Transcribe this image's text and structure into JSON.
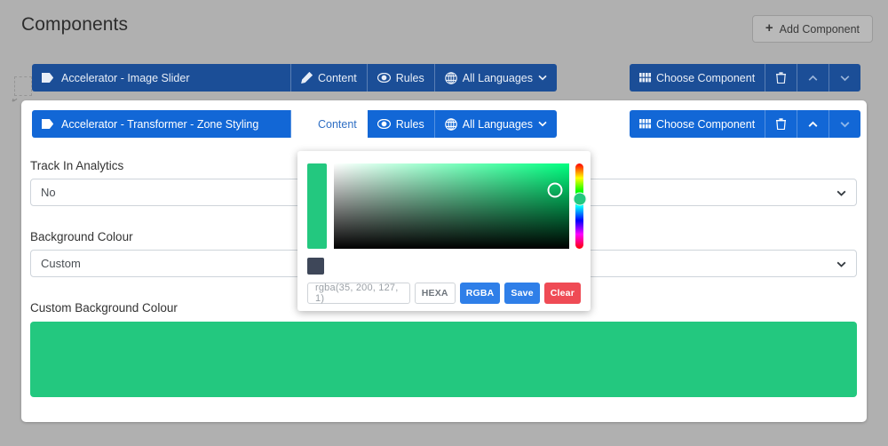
{
  "header": {
    "title": "Components",
    "add_button": {
      "label": "Add Component",
      "icon": "plus-icon"
    }
  },
  "component_rows": [
    {
      "id": "image-slider",
      "state": "inactive",
      "name": "Accelerator - Image Slider",
      "name_icon": "tag-icon",
      "tabs": [
        {
          "label": "Content",
          "icon": "pencil-icon",
          "active": false
        },
        {
          "label": "Rules",
          "icon": "eye-icon",
          "active": false
        },
        {
          "label": "All Languages",
          "icon": "globe-icon",
          "active": false,
          "caret": "chevron-down-icon"
        }
      ],
      "actions": [
        {
          "label": "Choose Component",
          "icon": "grid-icon"
        },
        {
          "label": "",
          "icon": "trash-icon"
        },
        {
          "label": "",
          "icon": "chevron-up-icon"
        },
        {
          "label": "",
          "icon": "chevron-down-icon"
        }
      ]
    },
    {
      "id": "zone-styling",
      "state": "active",
      "name": "Accelerator - Transformer - Zone Styling",
      "name_icon": "tag-icon",
      "tabs": [
        {
          "label": "Content",
          "icon": "pencil-icon",
          "active": true
        },
        {
          "label": "Rules",
          "icon": "eye-icon",
          "active": false
        },
        {
          "label": "All Languages",
          "icon": "globe-icon",
          "active": false,
          "caret": "chevron-down-icon"
        }
      ],
      "actions": [
        {
          "label": "Choose Component",
          "icon": "grid-icon"
        },
        {
          "label": "",
          "icon": "trash-icon"
        },
        {
          "label": "",
          "icon": "chevron-up-icon"
        },
        {
          "label": "",
          "icon": "chevron-down-icon"
        }
      ]
    }
  ],
  "form": {
    "track_in_analytics": {
      "label": "Track In Analytics",
      "value": "No"
    },
    "background_colour": {
      "label": "Background Colour",
      "value": "Custom"
    },
    "custom_background_colour": {
      "label": "Custom Background Colour",
      "swatch_color": "#23c87f"
    }
  },
  "color_picker": {
    "selected_color": "#23c87f",
    "input_value": "rgba(35, 200, 127, 1)",
    "saved_swatch_color": "#3e4759",
    "hue_degrees": 150,
    "buttons": [
      {
        "label": "HEXA",
        "style": "outline"
      },
      {
        "label": "RGBA",
        "style": "primary"
      },
      {
        "label": "Save",
        "style": "primary"
      },
      {
        "label": "Clear",
        "style": "danger"
      }
    ]
  },
  "colors": {
    "page_background": "#b0b0b0",
    "row_inactive_blue": "#1b4e97",
    "row_active_blue": "#1267d6",
    "accent_green": "#23c87f",
    "button_primary": "#2f7fe8",
    "button_danger": "#ef4b55"
  }
}
